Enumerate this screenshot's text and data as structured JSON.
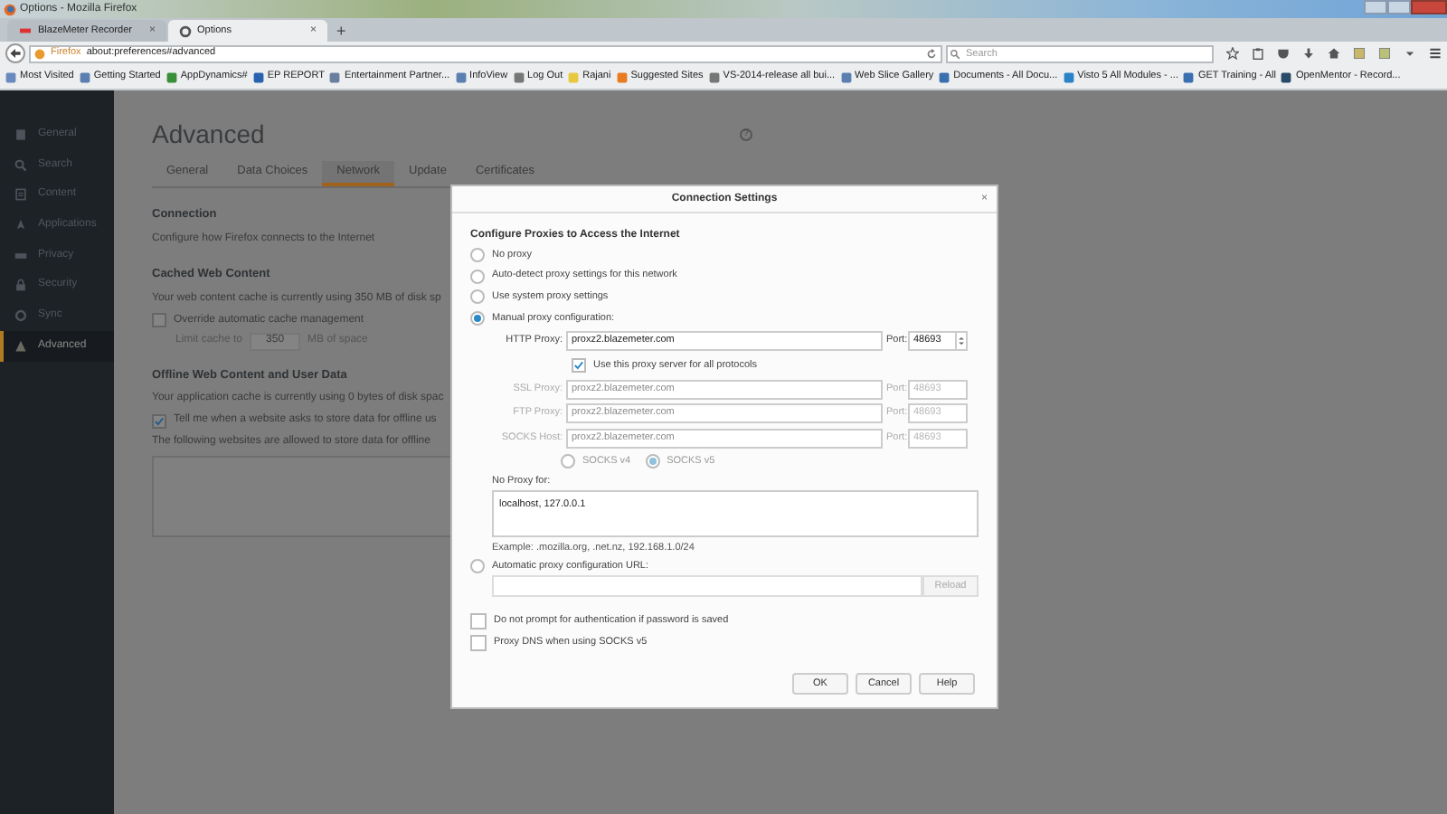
{
  "window": {
    "title": "Options - Mozilla Firefox"
  },
  "browser_tabs": [
    {
      "label": "BlazeMeter Recorder",
      "selected": false,
      "close": "×"
    },
    {
      "label": "Options",
      "selected": true,
      "close": "×"
    }
  ],
  "new_tab": "+",
  "address_bar": {
    "identity": "Firefox",
    "url": "about:preferences#advanced"
  },
  "search": {
    "placeholder": "Search"
  },
  "bookmarks": [
    "Most Visited",
    "Getting Started",
    "AppDynamics#",
    "EP REPORT",
    "Entertainment Partner...",
    "InfoView",
    "Log Out",
    "Rajani",
    "Suggested Sites",
    "VS-2014-release all bui...",
    "Web Slice Gallery",
    "Documents - All Docu...",
    "Visto 5 All Modules - ...",
    "GET Training - All",
    "OpenMentor - Record..."
  ],
  "sidebar": {
    "items": [
      {
        "label": "General",
        "selected": false
      },
      {
        "label": "Search",
        "selected": false
      },
      {
        "label": "Content",
        "selected": false
      },
      {
        "label": "Applications",
        "selected": false
      },
      {
        "label": "Privacy",
        "selected": false
      },
      {
        "label": "Security",
        "selected": false
      },
      {
        "label": "Sync",
        "selected": false
      },
      {
        "label": "Advanced",
        "selected": true
      }
    ]
  },
  "page": {
    "title": "Advanced",
    "help": "?",
    "tabs": [
      {
        "label": "General",
        "selected": false
      },
      {
        "label": "Data Choices",
        "selected": false
      },
      {
        "label": "Network",
        "selected": true
      },
      {
        "label": "Update",
        "selected": false
      },
      {
        "label": "Certificates",
        "selected": false
      }
    ],
    "connection": {
      "heading": "Connection",
      "text": "Configure how Firefox connects to the Internet"
    },
    "cache": {
      "heading": "Cached Web Content",
      "text": "Your web content cache is currently using 350 MB of disk sp",
      "override": {
        "label": "Override automatic cache management",
        "checked": false
      },
      "limit_label": "Limit cache to",
      "limit_value": "350",
      "limit_unit": "MB of space"
    },
    "offline": {
      "heading": "Offline Web Content and User Data",
      "text": "Your application cache is currently using 0 bytes of disk spac",
      "notify": {
        "label": "Tell me when a website asks to store data for offline us",
        "checked": true
      },
      "list_label": "The following websites are allowed to store data for offline"
    }
  },
  "dialog": {
    "title": "Connection Settings",
    "close": "×",
    "heading": "Configure Proxies to Access the Internet",
    "modes": [
      {
        "label": "No proxy",
        "selected": false
      },
      {
        "label": "Auto-detect proxy settings for this network",
        "selected": false
      },
      {
        "label": "Use system proxy settings",
        "selected": false
      },
      {
        "label": "Manual proxy configuration:",
        "selected": true
      }
    ],
    "proxies": [
      {
        "label": "HTTP Proxy:",
        "value": "proxz2.blazemeter.com",
        "port_label": "Port:",
        "port": "48693",
        "disabled": false
      },
      {
        "label": "SSL Proxy:",
        "value": "proxz2.blazemeter.com",
        "port_label": "Port:",
        "port": "48693",
        "disabled": true
      },
      {
        "label": "FTP Proxy:",
        "value": "proxz2.blazemeter.com",
        "port_label": "Port:",
        "port": "48693",
        "disabled": true
      },
      {
        "label": "SOCKS Host:",
        "value": "proxz2.blazemeter.com",
        "port_label": "Port:",
        "port": "48693",
        "disabled": true
      }
    ],
    "share_all": {
      "label": "Use this proxy server for all protocols",
      "checked": true
    },
    "socks_versions": [
      {
        "label": "SOCKS v4",
        "selected": false
      },
      {
        "label": "SOCKS v5",
        "selected": true
      }
    ],
    "no_proxy": {
      "label": "No Proxy for:",
      "value": "localhost, 127.0.0.1",
      "example": "Example: .mozilla.org, .net.nz, 192.168.1.0/24"
    },
    "auto_config": {
      "label": "Automatic proxy configuration URL:",
      "selected": false,
      "reload": "Reload"
    },
    "options": [
      {
        "label": "Do not prompt for authentication if password is saved",
        "checked": false
      },
      {
        "label": "Proxy DNS when using SOCKS v5",
        "checked": false
      }
    ],
    "buttons": [
      "OK",
      "Cancel",
      "Help"
    ]
  }
}
